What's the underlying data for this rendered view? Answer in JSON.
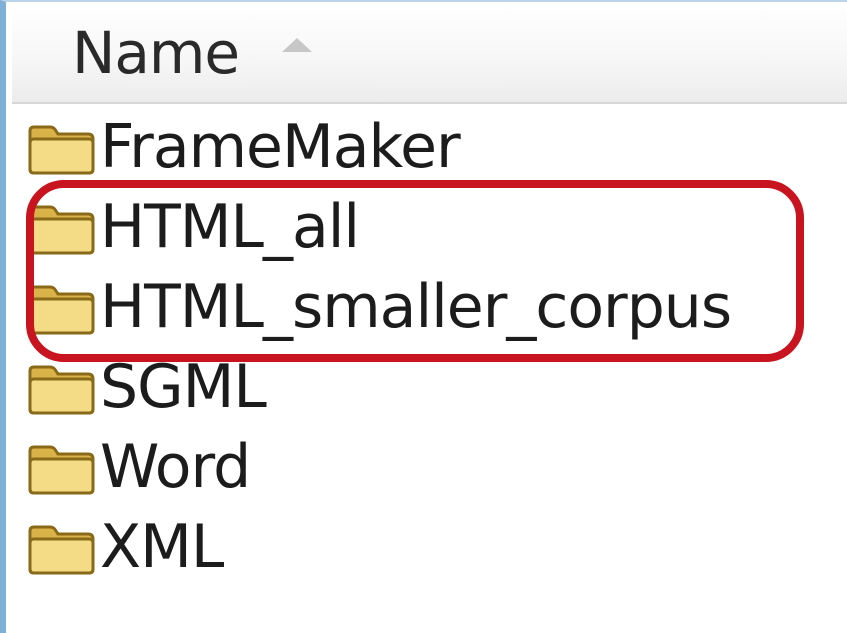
{
  "header": {
    "column_label": "Name",
    "sort_icon": "sort-ascending-arrow-icon"
  },
  "items": [
    {
      "label": "FrameMaker",
      "icon": "folder-icon"
    },
    {
      "label": "HTML_all",
      "icon": "folder-icon"
    },
    {
      "label": "HTML_smaller_corpus",
      "icon": "folder-icon"
    },
    {
      "label": "SGML",
      "icon": "folder-icon"
    },
    {
      "label": "Word",
      "icon": "folder-icon"
    },
    {
      "label": "XML",
      "icon": "folder-icon"
    }
  ],
  "colors": {
    "highlight": "#c8141e",
    "folder": "#f2d477",
    "window_border": "#7fb0d8"
  }
}
